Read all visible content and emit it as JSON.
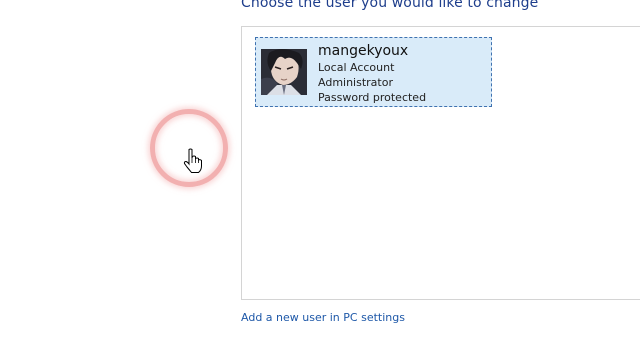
{
  "header": {
    "title": "Choose the user you would like to change"
  },
  "accounts": [
    {
      "name": "mangekyoux",
      "type": "Local Account",
      "role": "Administrator",
      "security": "Password protected"
    }
  ],
  "footer": {
    "add_user_link": "Add a new user in PC settings"
  },
  "icons": {
    "cursor": "hand-pointer-icon",
    "avatar": "user-avatar"
  },
  "colors": {
    "heading": "#1e3e8c",
    "link": "#1e58a8",
    "tile_bg": "#d9ebf9",
    "tile_border": "#3f72b0",
    "click_highlight": "#ee9696"
  }
}
